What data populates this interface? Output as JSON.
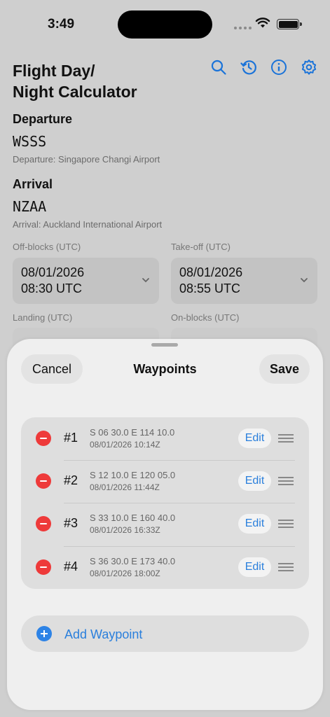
{
  "status_bar": {
    "time": "3:49"
  },
  "app": {
    "title": "Flight Day/\nNight Calculator",
    "toolbar": [
      {
        "name": "search-icon"
      },
      {
        "name": "history-icon"
      },
      {
        "name": "info-icon"
      },
      {
        "name": "settings-icon"
      }
    ]
  },
  "departure": {
    "heading": "Departure",
    "code": "WSSS",
    "description": "Departure: Singapore Changi Airport"
  },
  "arrival": {
    "heading": "Arrival",
    "code": "NZAA",
    "description": "Arrival: Auckland International Airport"
  },
  "times": {
    "off_blocks": {
      "label": "Off-blocks (UTC)",
      "date": "08/01/2026",
      "time": "08:30 UTC"
    },
    "take_off": {
      "label": "Take-off (UTC)",
      "date": "08/01/2026",
      "time": "08:55 UTC"
    },
    "landing": {
      "label": "Landing (UTC)"
    },
    "on_blocks": {
      "label": "On-blocks (UTC)"
    }
  },
  "sheet": {
    "title": "Waypoints",
    "cancel_label": "Cancel",
    "save_label": "Save",
    "waypoints": [
      {
        "number": "#1",
        "coords": "S 06 30.0 E 114 10.0",
        "time": "08/01/2026 10:14Z",
        "edit_label": "Edit"
      },
      {
        "number": "#2",
        "coords": "S 12 10.0 E 120 05.0",
        "time": "08/01/2026 11:44Z",
        "edit_label": "Edit"
      },
      {
        "number": "#3",
        "coords": "S 33 10.0 E 160 40.0",
        "time": "08/01/2026 16:33Z",
        "edit_label": "Edit"
      },
      {
        "number": "#4",
        "coords": "S 36 30.0 E 173 40.0",
        "time": "08/01/2026 18:00Z",
        "edit_label": "Edit"
      }
    ],
    "add_label": "Add Waypoint"
  },
  "colors": {
    "accent": "#2a7fdc",
    "delete": "#ee3a3a"
  }
}
